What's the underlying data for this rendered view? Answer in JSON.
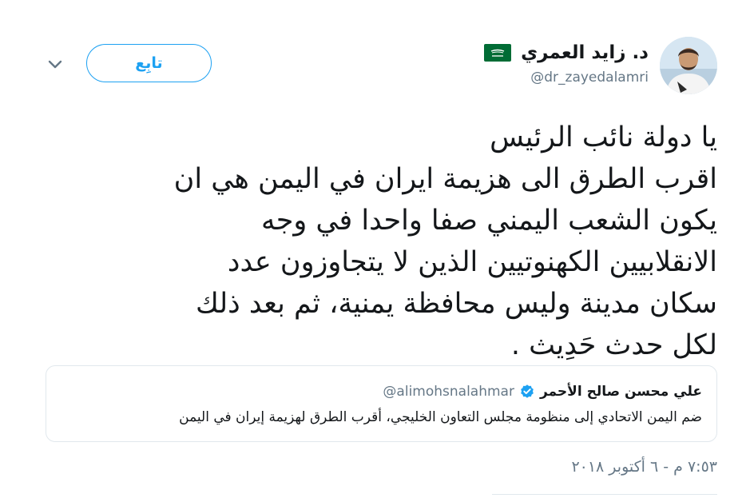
{
  "header": {
    "display_name": "د. زايد العمري",
    "handle": "@dr_zayedalamri",
    "follow_label": "تابِع",
    "flag_icon": "saudi-flag-icon",
    "avatar_icon": "user-avatar",
    "menu_icon": "chevron-down-icon"
  },
  "tweet": {
    "lines": [
      "يا دولة نائب الرئيس",
      "اقرب الطرق الى هزيمة ايران في اليمن هي ان",
      "يكون الشعب اليمني صفا واحدا في وجه",
      "الانقلابيين الكهنوتيين الذين لا يتجاوزون عدد",
      "سكان مدينة وليس محافظة يمنية، ثم بعد ذلك",
      "لكل حدث حَدِيث ."
    ],
    "timestamp": "٧:٥٣ م - ٦ أكتوبر ٢٠١٨"
  },
  "quoted": {
    "name": "علي محسن صالح الأحمر",
    "handle": "@alimohsnalahmar",
    "text": "ضم اليمن الاتحادي إلى منظومة مجلس التعاون الخليجي، أقرب الطرق لهزيمة إيران في اليمن",
    "verified_icon": "verified-badge-icon"
  },
  "colors": {
    "accent": "#1da1f2",
    "text": "#14171a",
    "muted": "#657786",
    "border": "#e1e8ed",
    "flag_green": "#006c35"
  }
}
